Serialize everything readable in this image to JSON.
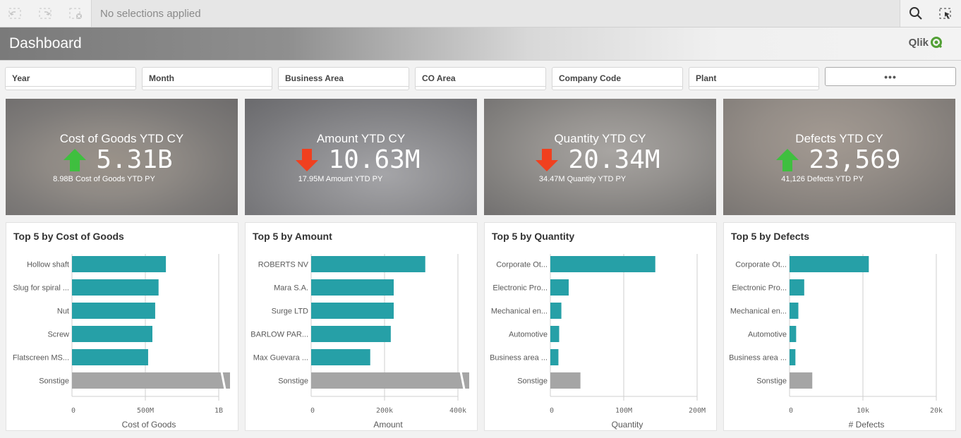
{
  "toolbar": {
    "selection_status": "No selections applied",
    "icons": [
      "step-back-icon",
      "step-forward-icon",
      "clear-selections-icon",
      "search-icon",
      "selection-tool-icon"
    ]
  },
  "header": {
    "title": "Dashboard",
    "logo_text": "Qlik",
    "logo_color": "#52a035"
  },
  "filters": [
    {
      "label": "Year"
    },
    {
      "label": "Month"
    },
    {
      "label": "Business Area"
    },
    {
      "label": "CO Area"
    },
    {
      "label": "Company Code"
    },
    {
      "label": "Plant"
    }
  ],
  "more_filters_label": "•••",
  "colors": {
    "bar": "#26a0a7",
    "other_bar": "#a5a5a5",
    "up_arrow": "#3fbf3f",
    "down_arrow": "#f0401f"
  },
  "kpis": [
    {
      "title": "Cost of Goods YTD CY",
      "value": "5.31B",
      "trend": "up",
      "subtitle": "8.98B Cost of Goods YTD PY",
      "background": "handshake-photo"
    },
    {
      "title": "Amount YTD CY",
      "value": "10.63M",
      "trend": "down",
      "subtitle": "17.95M Amount YTD PY",
      "background": "laptop-typing-photo"
    },
    {
      "title": "Quantity YTD CY",
      "value": "20.34M",
      "trend": "down",
      "subtitle": "34.47M Quantity YTD PY",
      "background": "business-people-photo"
    },
    {
      "title": "Defects YTD CY",
      "value": "23,569",
      "trend": "up",
      "subtitle": "41,126 Defects YTD PY",
      "background": "ceiling-damage-photo"
    }
  ],
  "chart_data": [
    {
      "type": "bar",
      "orientation": "horizontal",
      "title": "Top 5 by Cost of Goods",
      "categories": [
        "Hollow shaft",
        "Slug for spiral ...",
        "Nut",
        "Screw",
        "Flatscreen MS...",
        "Sonstige"
      ],
      "values": [
        640000000,
        590000000,
        567000000,
        548000000,
        519000000,
        1100000000
      ],
      "other_truncated": true,
      "xlabel": "Cost of Goods",
      "ylabel": "",
      "xlim": [
        0,
        1000000000
      ],
      "ticks": [
        {
          "v": 0,
          "label": "0"
        },
        {
          "v": 500000000,
          "label": "500M"
        },
        {
          "v": 1000000000,
          "label": "1B"
        }
      ],
      "grid": true
    },
    {
      "type": "bar",
      "orientation": "horizontal",
      "title": "Top 5 by Amount",
      "categories": [
        "ROBERTS NV",
        "Mara  S.A.",
        "Surge  LTD",
        "BARLOW PAR...",
        "Max Guevara  ...",
        "Sonstige"
      ],
      "values": [
        311000,
        225000,
        225000,
        217000,
        161000,
        440000
      ],
      "other_truncated": true,
      "xlabel": "Amount",
      "ylabel": "",
      "xlim": [
        0,
        400000
      ],
      "ticks": [
        {
          "v": 0,
          "label": "0"
        },
        {
          "v": 200000,
          "label": "200k"
        },
        {
          "v": 400000,
          "label": "400k"
        }
      ],
      "grid": true
    },
    {
      "type": "bar",
      "orientation": "horizontal",
      "title": "Top 5 by Quantity",
      "categories": [
        "Corporate Ot...",
        "Electronic Pro...",
        "Mechanical en...",
        "Automotive",
        "Business area ...",
        "Sonstige"
      ],
      "values": [
        143000000,
        25000000,
        15000000,
        12000000,
        11000000,
        41000000
      ],
      "other_truncated": false,
      "xlabel": "Quantity",
      "ylabel": "",
      "xlim": [
        0,
        200000000
      ],
      "ticks": [
        {
          "v": 0,
          "label": "0"
        },
        {
          "v": 100000000,
          "label": "100M"
        },
        {
          "v": 200000000,
          "label": "200M"
        }
      ],
      "grid": true
    },
    {
      "type": "bar",
      "orientation": "horizontal",
      "title": "Top 5 by Defects",
      "categories": [
        "Corporate Ot...",
        "Electronic Pro...",
        "Mechanical en...",
        "Automotive",
        "Business area ...",
        "Sonstige"
      ],
      "values": [
        10800,
        2000,
        1200,
        900,
        800,
        3100
      ],
      "other_truncated": false,
      "xlabel": "# Defects",
      "ylabel": "",
      "xlim": [
        0,
        20000
      ],
      "ticks": [
        {
          "v": 0,
          "label": "0"
        },
        {
          "v": 10000,
          "label": "10k"
        },
        {
          "v": 20000,
          "label": "20k"
        }
      ],
      "grid": true
    }
  ]
}
